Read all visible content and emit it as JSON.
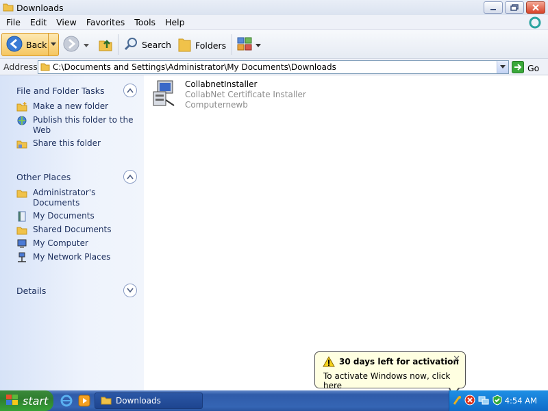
{
  "window": {
    "title": "Downloads"
  },
  "menu": [
    "File",
    "Edit",
    "View",
    "Favorites",
    "Tools",
    "Help"
  ],
  "toolbar": {
    "back_label": "Back",
    "search_label": "Search",
    "folders_label": "Folders"
  },
  "address": {
    "label": "Address",
    "path": "C:\\Documents and Settings\\Administrator\\My Documents\\Downloads",
    "go_label": "Go"
  },
  "taskpane": {
    "file_tasks": {
      "title": "File and Folder Tasks",
      "items": [
        "Make a new folder",
        "Publish this folder to the Web",
        "Share this folder"
      ]
    },
    "other_places": {
      "title": "Other Places",
      "items": [
        "Administrator's Documents",
        "My Documents",
        "Shared Documents",
        "My Computer",
        "My Network Places"
      ]
    },
    "details": {
      "title": "Details"
    }
  },
  "files": [
    {
      "name": "CollabnetInstaller",
      "description": "CollabNet Certificate Installer",
      "company": "Computernewb"
    }
  ],
  "balloon": {
    "title": "30 days left for activation",
    "text": "To activate Windows now, click here"
  },
  "taskbar": {
    "start_label": "start",
    "window_button": "Downloads",
    "clock": "4:54 AM"
  }
}
